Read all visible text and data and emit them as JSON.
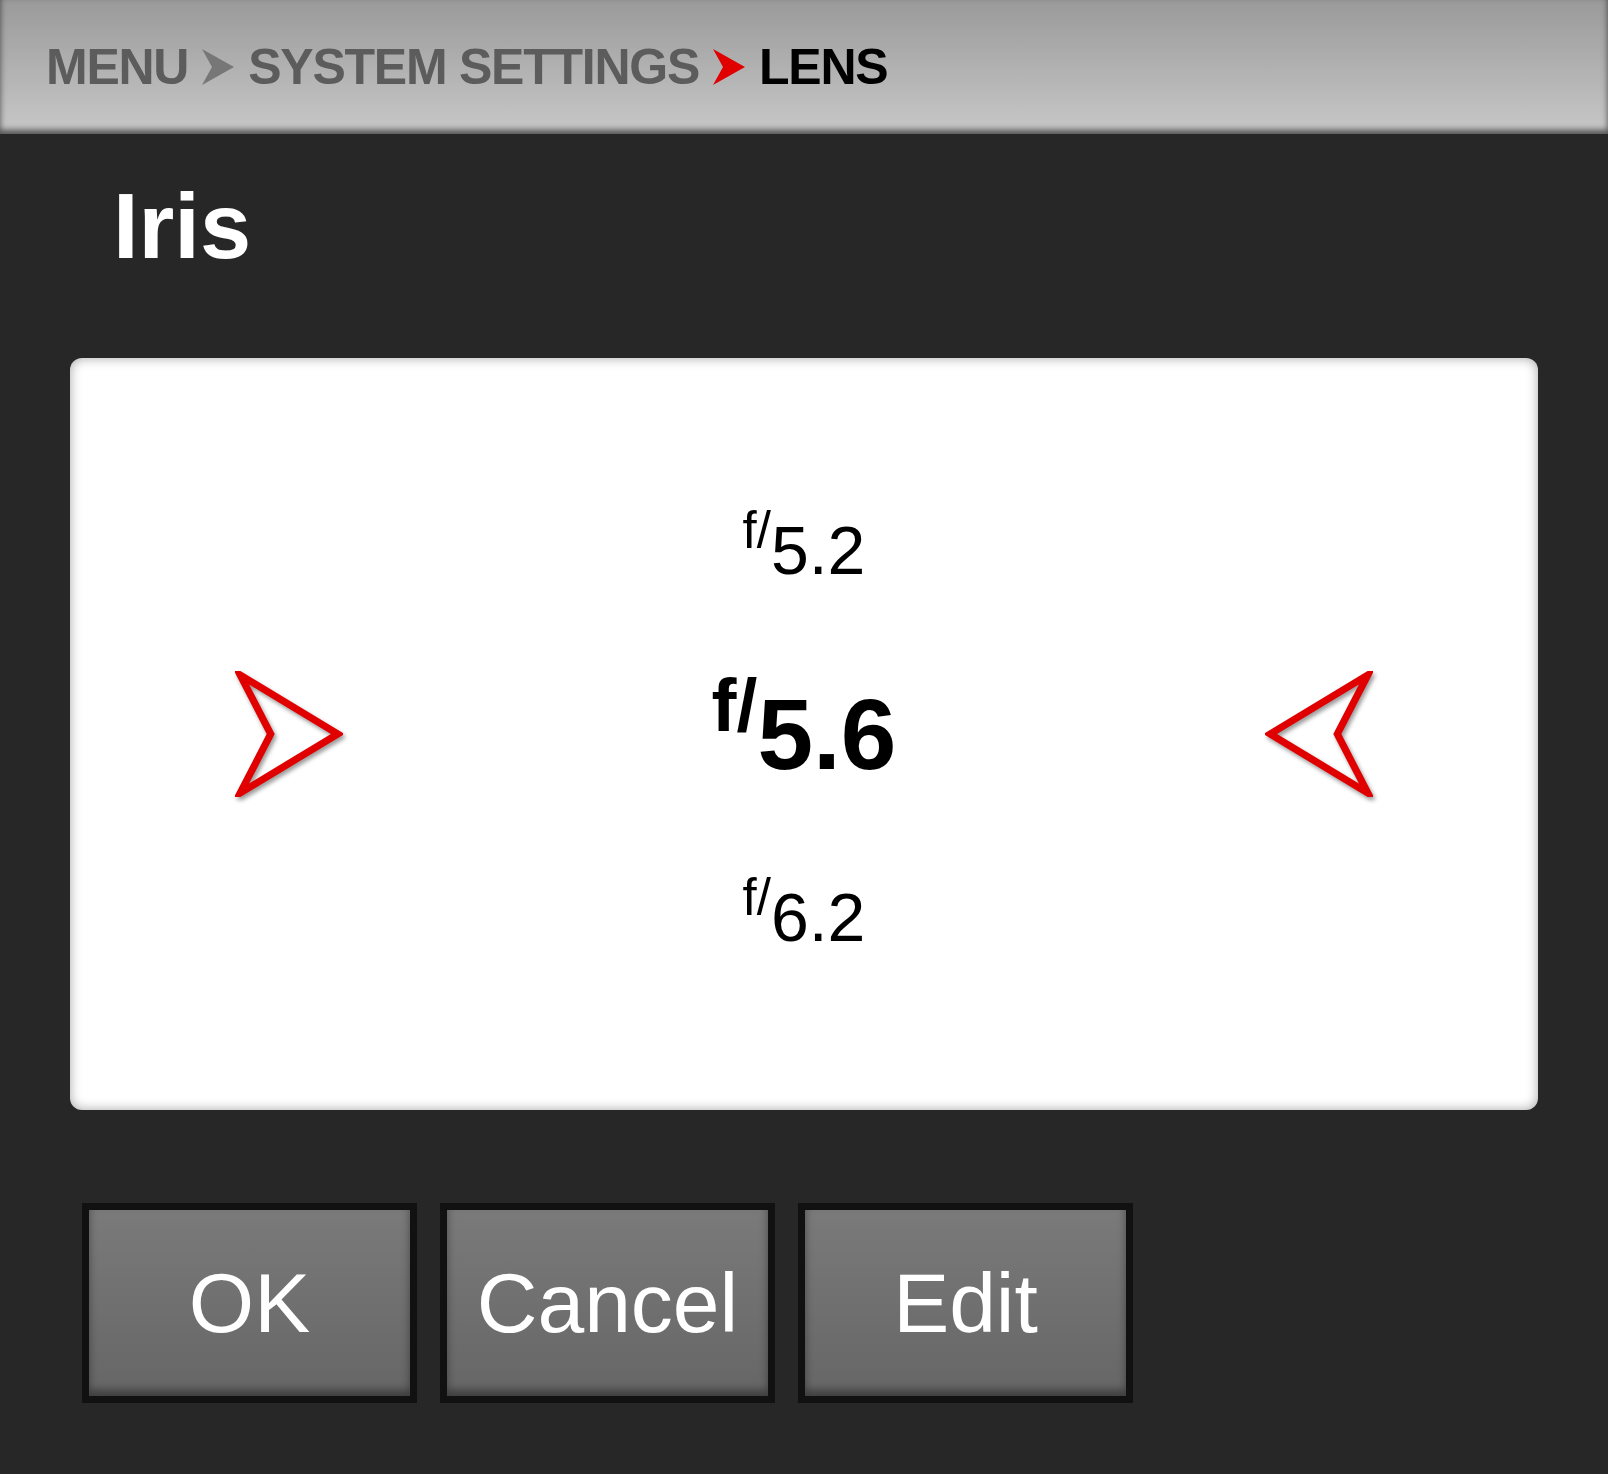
{
  "breadcrumb": [
    {
      "label": "MENU",
      "current": false
    },
    {
      "label": "SYSTEM SETTINGS",
      "current": false
    },
    {
      "label": "LENS",
      "current": true
    }
  ],
  "title": "Iris",
  "options": [
    {
      "label": "$^{f/}$5.2",
      "selected": false
    },
    {
      "label": "$^{f/}$5.6",
      "selected": true
    },
    {
      "label": "$^{f/}$6.2",
      "selected": false
    }
  ],
  "buttons": [
    "OK",
    "Cancel",
    "Edit"
  ]
}
